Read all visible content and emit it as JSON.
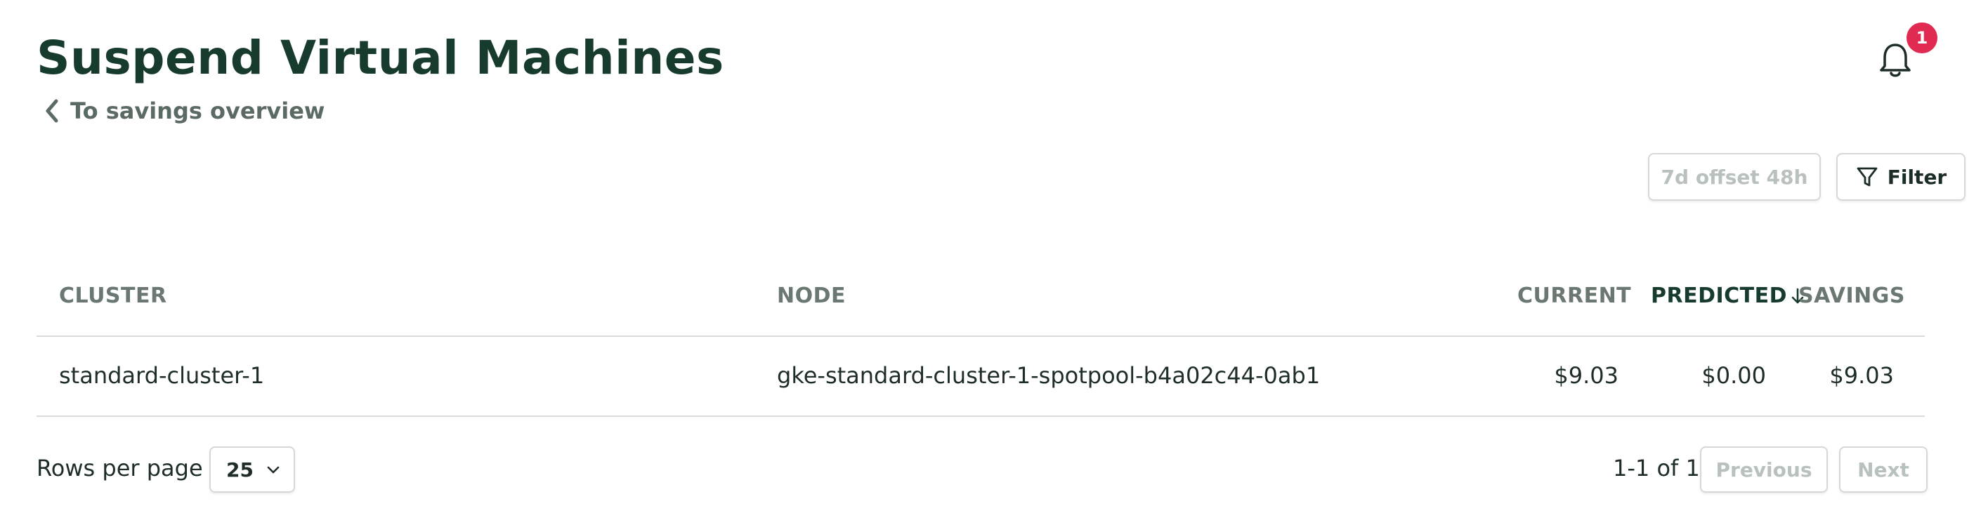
{
  "header": {
    "title": "Suspend Virtual Machines",
    "back_link": "To savings overview",
    "notification_count": "1"
  },
  "toolbar": {
    "offset_label": "7d offset 48h",
    "filter_label": "Filter"
  },
  "table": {
    "columns": {
      "cluster": "CLUSTER",
      "node": "NODE",
      "current": "CURRENT",
      "predicted": "PREDICTED",
      "savings": "SAVINGS"
    },
    "sort": {
      "column": "predicted",
      "direction": "desc"
    },
    "rows": [
      {
        "cluster": "standard-cluster-1",
        "node": "gke-standard-cluster-1-spotpool-b4a02c44-0ab1",
        "current": "$9.03",
        "predicted": "$0.00",
        "savings": "$9.03"
      }
    ]
  },
  "pagination": {
    "rows_per_page_label": "Rows per page",
    "rows_per_page_value": "25",
    "range_text": "1-1 of 1",
    "previous_label": "Previous",
    "next_label": "Next"
  },
  "colors": {
    "title": "#173b2c",
    "badge": "#e02a52",
    "muted": "#6a7871",
    "disabled": "#b9c1bd",
    "border": "#d4d9d6"
  },
  "icons": [
    "chevron-left-icon",
    "bell-icon",
    "filter-icon",
    "arrow-down-icon",
    "chevron-down-icon"
  ]
}
